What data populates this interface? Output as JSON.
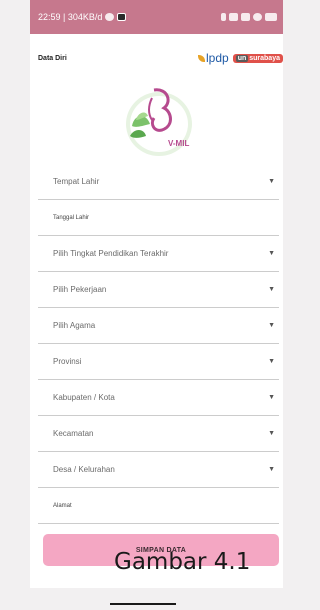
{
  "status_bar": {
    "time_info": "22:59 | 304KB/d",
    "icons": [
      "settings-icon",
      "app-icon",
      "bluetooth-icon",
      "signal-icon",
      "signal-icon",
      "wifi-icon",
      "battery-icon"
    ]
  },
  "header": {
    "title": "Data Diri",
    "logo_lpdp": "lpdp",
    "logo_unesa_prefix": "un",
    "logo_unesa_suffix": "surabaya"
  },
  "app_logo": {
    "text": "V-MIL"
  },
  "form": {
    "fields": [
      {
        "label": "Tempat Lahir",
        "type": "select"
      },
      {
        "label": "Tanggal Lahir",
        "type": "input"
      },
      {
        "label": "Pilih Tingkat Pendidikan Terakhir",
        "type": "select"
      },
      {
        "label": "Pilih Pekerjaan",
        "type": "select"
      },
      {
        "label": "Pilih Agama",
        "type": "select"
      },
      {
        "label": "Provinsi",
        "type": "select"
      },
      {
        "label": "Kabupaten / Kota",
        "type": "select"
      },
      {
        "label": "Kecamatan",
        "type": "select"
      },
      {
        "label": "Desa / Kelurahan",
        "type": "select"
      },
      {
        "label": "Alamat",
        "type": "input"
      }
    ],
    "submit_label": "SIMPAN DATA"
  },
  "caption": "Gambar 4.1",
  "colors": {
    "status_bar": "#c6788d",
    "button": "#f4a7c3",
    "logo_green": "#7cc26b",
    "logo_pink": "#b64a8e"
  }
}
